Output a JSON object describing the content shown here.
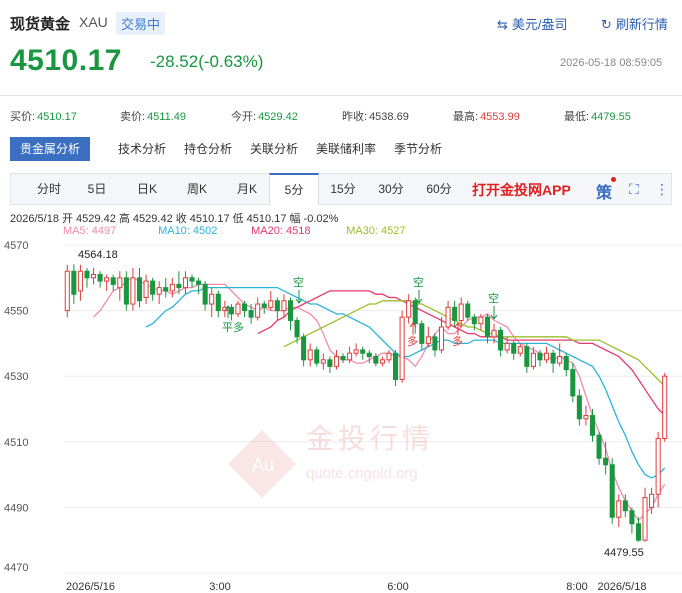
{
  "header": {
    "title": "现货黄金",
    "code": "XAU",
    "status": "交易中",
    "currency_label": "美元/盎司",
    "refresh_label": "刷新行情",
    "price": "4510.17",
    "change": "-28.52(-0.63%)",
    "timestamp": "2026-05-18 08:59:05"
  },
  "quotes": [
    {
      "label": "买价:",
      "value": "4510.17",
      "color": "green"
    },
    {
      "label": "卖价:",
      "value": "4511.49",
      "color": "green"
    },
    {
      "label": "今开:",
      "value": "4529.42",
      "color": "green"
    },
    {
      "label": "昨收:",
      "value": "4538.69",
      "color": "plain"
    },
    {
      "label": "最高:",
      "value": "4553.99",
      "color": "red"
    },
    {
      "label": "最低:",
      "value": "4479.55",
      "color": "green"
    }
  ],
  "analysis_tabs": [
    "贵金属分析",
    "技术分析",
    "持仓分析",
    "关联分析",
    "美联储利率",
    "季节分析"
  ],
  "period_tabs": [
    "分时",
    "5日",
    "日K",
    "周K",
    "月K",
    "5分",
    "15分",
    "30分",
    "60分"
  ],
  "active_period": "5分",
  "app_link": "打开金投网APP",
  "strategy_icon": "策",
  "ohlc": "2026/5/18  开 4529.42  高 4529.42  收 4510.17  低 4510.17  幅 -0.02%",
  "ma": [
    {
      "label": "MA5: 4497",
      "color": "#f08cae"
    },
    {
      "label": "MA10: 4502",
      "color": "#2bb3d8"
    },
    {
      "label": "MA20: 4518",
      "color": "#e6396b"
    },
    {
      "label": "MA30: 4527",
      "color": "#9cbf2a"
    }
  ],
  "watermark": {
    "text": "金投行情",
    "sub": "quote.cngold.org",
    "badge": "Au"
  },
  "chart_data": {
    "type": "candlestick",
    "ylim": [
      4470,
      4570
    ],
    "yticks": [
      "4570",
      "4550",
      "4530",
      "4510",
      "4490",
      "4470"
    ],
    "xticks": [
      "2026/5/16",
      "3:00",
      "6:00",
      "8:00",
      "2026/5/18"
    ],
    "annotations": [
      "4564.18",
      "4479.55",
      "平多",
      "空",
      "空",
      "空",
      "多",
      "多"
    ],
    "colors": {
      "up": "#e03c3c",
      "down": "#1a9641"
    },
    "candles": [
      {
        "o": 4550,
        "c": 4562,
        "h": 4564,
        "l": 4548
      },
      {
        "o": 4562,
        "c": 4555,
        "h": 4564.18,
        "l": 4552
      },
      {
        "o": 4556,
        "c": 4562,
        "h": 4564,
        "l": 4553
      },
      {
        "o": 4562,
        "c": 4560,
        "h": 4563,
        "l": 4557
      },
      {
        "o": 4560,
        "c": 4561,
        "h": 4563,
        "l": 4558
      },
      {
        "o": 4561,
        "c": 4559,
        "h": 4562,
        "l": 4557
      },
      {
        "o": 4559,
        "c": 4560,
        "h": 4561,
        "l": 4556
      },
      {
        "o": 4560,
        "c": 4558,
        "h": 4561,
        "l": 4556
      },
      {
        "o": 4557,
        "c": 4560,
        "h": 4562,
        "l": 4553
      },
      {
        "o": 4560,
        "c": 4552,
        "h": 4562,
        "l": 4550
      },
      {
        "o": 4552,
        "c": 4560,
        "h": 4563,
        "l": 4550
      },
      {
        "o": 4560,
        "c": 4553,
        "h": 4563,
        "l": 4551
      },
      {
        "o": 4554,
        "c": 4559,
        "h": 4561,
        "l": 4552
      },
      {
        "o": 4559,
        "c": 4555,
        "h": 4560,
        "l": 4553
      },
      {
        "o": 4555,
        "c": 4557,
        "h": 4559,
        "l": 4552
      },
      {
        "o": 4557,
        "c": 4556,
        "h": 4560,
        "l": 4554
      },
      {
        "o": 4556,
        "c": 4558,
        "h": 4560,
        "l": 4554
      },
      {
        "o": 4558,
        "c": 4557,
        "h": 4562,
        "l": 4555
      },
      {
        "o": 4557,
        "c": 4560,
        "h": 4562,
        "l": 4555
      },
      {
        "o": 4560,
        "c": 4559,
        "h": 4561,
        "l": 4557
      },
      {
        "o": 4559,
        "c": 4558,
        "h": 4560,
        "l": 4555
      },
      {
        "o": 4558,
        "c": 4552,
        "h": 4559,
        "l": 4550
      },
      {
        "o": 4552,
        "c": 4555,
        "h": 4557,
        "l": 4548
      },
      {
        "o": 4555,
        "c": 4550,
        "h": 4556,
        "l": 4548
      },
      {
        "o": 4550,
        "c": 4551,
        "h": 4553,
        "l": 4548
      },
      {
        "o": 4551,
        "c": 4549,
        "h": 4552,
        "l": 4547
      },
      {
        "o": 4549,
        "c": 4552,
        "h": 4553,
        "l": 4548
      },
      {
        "o": 4552,
        "c": 4550,
        "h": 4553,
        "l": 4548
      },
      {
        "o": 4550,
        "c": 4548,
        "h": 4552,
        "l": 4546
      },
      {
        "o": 4548,
        "c": 4552,
        "h": 4554,
        "l": 4547
      },
      {
        "o": 4552,
        "c": 4551,
        "h": 4553,
        "l": 4549
      },
      {
        "o": 4551,
        "c": 4553,
        "h": 4556,
        "l": 4550
      },
      {
        "o": 4553,
        "c": 4550,
        "h": 4554,
        "l": 4547
      },
      {
        "o": 4550,
        "c": 4553,
        "h": 4555,
        "l": 4548
      },
      {
        "o": 4553,
        "c": 4547,
        "h": 4554,
        "l": 4544
      },
      {
        "o": 4547,
        "c": 4542,
        "h": 4548,
        "l": 4540
      },
      {
        "o": 4542,
        "c": 4535,
        "h": 4543,
        "l": 4533
      },
      {
        "o": 4535,
        "c": 4538,
        "h": 4540,
        "l": 4533
      },
      {
        "o": 4538,
        "c": 4534,
        "h": 4539,
        "l": 4533
      },
      {
        "o": 4534,
        "c": 4535,
        "h": 4537,
        "l": 4532
      },
      {
        "o": 4535,
        "c": 4533,
        "h": 4536,
        "l": 4531
      },
      {
        "o": 4533,
        "c": 4536,
        "h": 4538,
        "l": 4532
      },
      {
        "o": 4536,
        "c": 4535,
        "h": 4537,
        "l": 4534
      },
      {
        "o": 4535,
        "c": 4537,
        "h": 4539,
        "l": 4534
      },
      {
        "o": 4537,
        "c": 4538,
        "h": 4540,
        "l": 4536
      },
      {
        "o": 4538,
        "c": 4537,
        "h": 4539,
        "l": 4535
      },
      {
        "o": 4537,
        "c": 4536,
        "h": 4538,
        "l": 4534
      },
      {
        "o": 4536,
        "c": 4534,
        "h": 4537,
        "l": 4533
      },
      {
        "o": 4534,
        "c": 4535,
        "h": 4536,
        "l": 4533
      },
      {
        "o": 4535,
        "c": 4537,
        "h": 4538,
        "l": 4534
      },
      {
        "o": 4537,
        "c": 4529,
        "h": 4538,
        "l": 4527
      },
      {
        "o": 4529,
        "c": 4548,
        "h": 4550,
        "l": 4528
      },
      {
        "o": 4548,
        "c": 4553,
        "h": 4555,
        "l": 4546
      },
      {
        "o": 4553,
        "c": 4546,
        "h": 4554,
        "l": 4543
      },
      {
        "o": 4546,
        "c": 4540,
        "h": 4547,
        "l": 4538
      },
      {
        "o": 4540,
        "c": 4542,
        "h": 4545,
        "l": 4539
      },
      {
        "o": 4542,
        "c": 4538,
        "h": 4543,
        "l": 4536
      },
      {
        "o": 4538,
        "c": 4545,
        "h": 4548,
        "l": 4537
      },
      {
        "o": 4545,
        "c": 4551,
        "h": 4553,
        "l": 4544
      },
      {
        "o": 4551,
        "c": 4547,
        "h": 4553,
        "l": 4545
      },
      {
        "o": 4547,
        "c": 4552,
        "h": 4554,
        "l": 4545
      },
      {
        "o": 4552,
        "c": 4548,
        "h": 4553,
        "l": 4547
      },
      {
        "o": 4548,
        "c": 4546,
        "h": 4549,
        "l": 4544
      },
      {
        "o": 4546,
        "c": 4548,
        "h": 4549,
        "l": 4544
      },
      {
        "o": 4548,
        "c": 4542,
        "h": 4549,
        "l": 4540
      },
      {
        "o": 4542,
        "c": 4544,
        "h": 4546,
        "l": 4540
      },
      {
        "o": 4544,
        "c": 4538,
        "h": 4545,
        "l": 4536
      },
      {
        "o": 4538,
        "c": 4540,
        "h": 4542,
        "l": 4537
      },
      {
        "o": 4540,
        "c": 4537,
        "h": 4541,
        "l": 4535
      },
      {
        "o": 4537,
        "c": 4539,
        "h": 4540,
        "l": 4536
      },
      {
        "o": 4539,
        "c": 4533,
        "h": 4540,
        "l": 4531
      },
      {
        "o": 4533,
        "c": 4537,
        "h": 4539,
        "l": 4532
      },
      {
        "o": 4537,
        "c": 4535,
        "h": 4538,
        "l": 4533
      },
      {
        "o": 4535,
        "c": 4537,
        "h": 4539,
        "l": 4534
      },
      {
        "o": 4537,
        "c": 4534,
        "h": 4538,
        "l": 4531
      },
      {
        "o": 4534,
        "c": 4536,
        "h": 4540,
        "l": 4533
      },
      {
        "o": 4536,
        "c": 4532,
        "h": 4537,
        "l": 4530
      },
      {
        "o": 4532,
        "c": 4524,
        "h": 4534,
        "l": 4522
      },
      {
        "o": 4524,
        "c": 4517,
        "h": 4526,
        "l": 4515
      },
      {
        "o": 4517,
        "c": 4518,
        "h": 4521,
        "l": 4515
      },
      {
        "o": 4518,
        "c": 4512,
        "h": 4520,
        "l": 4510
      },
      {
        "o": 4512,
        "c": 4505,
        "h": 4513,
        "l": 4503
      },
      {
        "o": 4505,
        "c": 4503,
        "h": 4510,
        "l": 4500
      },
      {
        "o": 4503,
        "c": 4487,
        "h": 4505,
        "l": 4485
      },
      {
        "o": 4487,
        "c": 4492,
        "h": 4494,
        "l": 4484
      },
      {
        "o": 4492,
        "c": 4489,
        "h": 4494,
        "l": 4487
      },
      {
        "o": 4489,
        "c": 4485,
        "h": 4490,
        "l": 4482
      },
      {
        "o": 4485,
        "c": 4480,
        "h": 4487,
        "l": 4479.55
      },
      {
        "o": 4480,
        "c": 4493,
        "h": 4496,
        "l": 4479.55
      },
      {
        "o": 4490,
        "c": 4494,
        "h": 4496,
        "l": 4488
      },
      {
        "o": 4494,
        "c": 4511,
        "h": 4513,
        "l": 4490
      },
      {
        "o": 4511,
        "c": 4530,
        "h": 4531,
        "l": 4510
      }
    ],
    "ma_series": [
      {
        "name": "MA5",
        "color": "#f08cae",
        "values": [
          4548,
          4550,
          4553,
          4556,
          4557,
          4559,
          4560,
          4559,
          4558,
          4557,
          4556,
          4556,
          4555,
          4556,
          4557,
          4557,
          4558,
          4558,
          4558,
          4558,
          4558,
          4556,
          4554,
          4552,
          4551,
          4550,
          4551,
          4550,
          4550,
          4550,
          4551,
          4551,
          4550,
          4549,
          4547,
          4543,
          4538,
          4536,
          4535,
          4535,
          4534,
          4534,
          4535,
          4536,
          4537,
          4537,
          4536,
          4536,
          4535,
          4533,
          4536,
          4540,
          4543,
          4545,
          4543,
          4543,
          4545,
          4547,
          4548,
          4548,
          4549,
          4547,
          4546,
          4545,
          4542,
          4540,
          4539,
          4538,
          4537,
          4536,
          4535,
          4536,
          4535,
          4534,
          4530,
          4524,
          4518,
          4513,
          4508,
          4501,
          4496,
          4492,
          4489,
          4486,
          4488,
          4490,
          4494,
          4497
        ]
      },
      {
        "name": "MA10",
        "color": "#2bb3d8",
        "values": [
          4545,
          4546,
          4548,
          4550,
          4551,
          4553,
          4555,
          4556,
          4556,
          4557,
          4557,
          4557,
          4557,
          4557,
          4557,
          4557,
          4557,
          4557,
          4557,
          4557,
          4557,
          4556,
          4555,
          4554,
          4553,
          4552,
          4552,
          4551,
          4550,
          4549,
          4549,
          4548,
          4547,
          4546,
          4545,
          4543,
          4541,
          4539,
          4537,
          4536,
          4536,
          4537,
          4538,
          4539,
          4540,
          4541,
          4541,
          4540,
          4540,
          4540,
          4541,
          4541,
          4541,
          4541,
          4540,
          4540,
          4540,
          4540,
          4540,
          4540,
          4540,
          4540,
          4539,
          4538,
          4537,
          4536,
          4535,
          4534,
          4533,
          4530,
          4526,
          4521,
          4516,
          4512,
          4507,
          4503,
          4500,
          4499,
          4500,
          4502
        ]
      },
      {
        "name": "MA20",
        "color": "#e6396b",
        "values": [
          4543,
          4544,
          4545,
          4547,
          4548,
          4550,
          4551,
          4552,
          4553,
          4554,
          4555,
          4556,
          4556,
          4556,
          4556,
          4556,
          4556,
          4556,
          4555,
          4555,
          4554,
          4554,
          4553,
          4552,
          4551,
          4550,
          4549,
          4548,
          4547,
          4546,
          4545,
          4544,
          4543,
          4543,
          4542,
          4542,
          4542,
          4542,
          4541,
          4541,
          4541,
          4541,
          4541,
          4541,
          4541,
          4541,
          4541,
          4541,
          4541,
          4540,
          4540,
          4540,
          4539,
          4538,
          4537,
          4536,
          4534,
          4532,
          4529,
          4526,
          4523,
          4520,
          4518
        ]
      },
      {
        "name": "MA30",
        "color": "#9cbf2a",
        "values": [
          4539,
          4540,
          4541,
          4542,
          4543,
          4544,
          4545,
          4546,
          4547,
          4548,
          4549,
          4550,
          4551,
          4552,
          4552,
          4553,
          4553,
          4553,
          4553,
          4553,
          4552,
          4552,
          4551,
          4550,
          4549,
          4548,
          4547,
          4546,
          4545,
          4545,
          4544,
          4543,
          4543,
          4542,
          4542,
          4542,
          4542,
          4542,
          4542,
          4542,
          4542,
          4542,
          4542,
          4542,
          4541,
          4541,
          4541,
          4541,
          4541,
          4540,
          4539,
          4538,
          4537,
          4536,
          4535,
          4533,
          4531,
          4529,
          4527
        ]
      }
    ]
  }
}
